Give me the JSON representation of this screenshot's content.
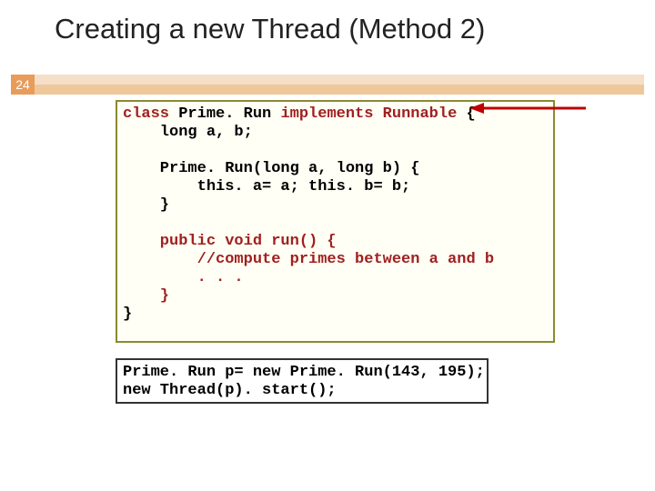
{
  "title": "Creating a new Thread (Method 2)",
  "slideNumber": "24",
  "code1": {
    "l1a": "class",
    "l1b": " Prime. Run ",
    "l1c": "implements",
    "l1d": " ",
    "l1e": "Runnable",
    "l1f": " {",
    "l2": "    long a, b;",
    "l3": "",
    "l4": "    Prime. Run(long a, long b) {",
    "l5": "        this. a= a; this. b= b;",
    "l6": "    }",
    "l7": "",
    "l8a": "    public void run() {",
    "l9": "        //compute primes between a and b",
    "l10": "        . . .",
    "l11": "    }",
    "l12": "}"
  },
  "code2": {
    "l1": "Prime. Run p= new Prime. Run(143, 195);",
    "l2": "new Thread(p). start();"
  },
  "colors": {
    "keyword": "#a02020",
    "arrow": "#c00000",
    "boxBorder1": "#8a8a30",
    "numBg": "#e89c5b"
  }
}
